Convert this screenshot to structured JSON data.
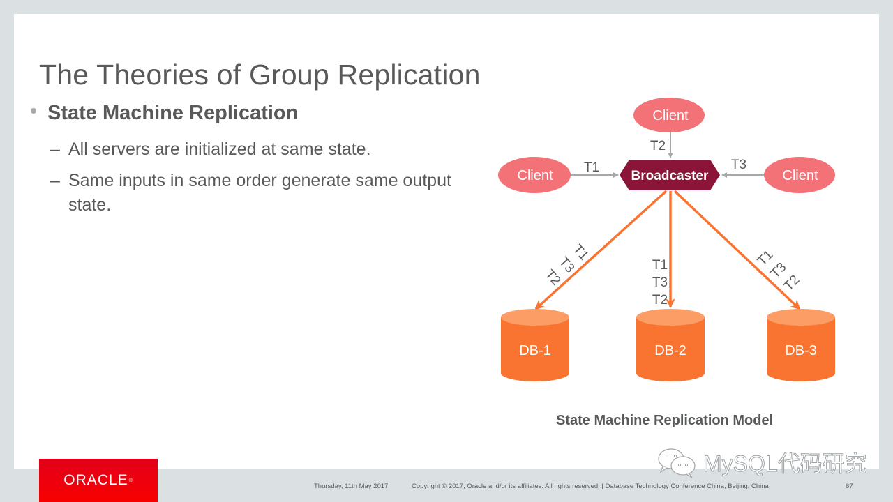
{
  "slide": {
    "title": "The Theories of Group Replication",
    "bullets": [
      {
        "text": "State Machine Replication",
        "sub": [
          "All servers are initialized at same state.",
          "Same inputs in same order generate same output state."
        ]
      }
    ],
    "dash": "–"
  },
  "diagram": {
    "clients": [
      {
        "id": "client-top",
        "label": "Client"
      },
      {
        "id": "client-left",
        "label": "Client"
      },
      {
        "id": "client-right",
        "label": "Client"
      }
    ],
    "broadcaster": "Broadcaster",
    "inputs": [
      {
        "from": "client-left",
        "label": "T1"
      },
      {
        "from": "client-top",
        "label": "T2"
      },
      {
        "from": "client-right",
        "label": "T3"
      }
    ],
    "databases": [
      {
        "label": "DB-1",
        "order": [
          "T1",
          "T3",
          "T2"
        ]
      },
      {
        "label": "DB-2",
        "order": [
          "T1",
          "T3",
          "T2"
        ]
      },
      {
        "label": "DB-3",
        "order": [
          "T1",
          "T3",
          "T2"
        ]
      }
    ],
    "caption": "State Machine Replication Model",
    "colors": {
      "client": "#f27278",
      "broadcaster": "#8b1538",
      "db_body": "#f97331",
      "db_top": "#fb9d64",
      "arrow_out": "#f97331",
      "arrow_in": "#a6a8ab",
      "text": "#58595b"
    }
  },
  "footer": {
    "logo": "ORACLE",
    "date": "Thursday, 11th May 2017",
    "copyright": "Copyright © 2017, Oracle and/or its affiliates. All rights reserved.  |  Database Technology Conference China, Beijing, China",
    "page": "67"
  },
  "watermark": {
    "icon": "wechat-icon",
    "text": "MySQL代码研究"
  }
}
